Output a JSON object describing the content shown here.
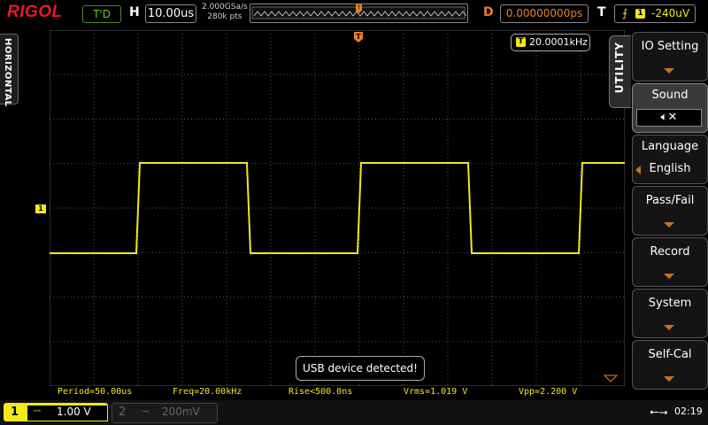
{
  "header": {
    "brand": "RIGOL",
    "run_status": "T'D",
    "h_label": "H",
    "timebase": "10.00us",
    "sample_rate": "2.000GSa/s",
    "memory_depth": "280k pts",
    "d_label": "D",
    "delay": "0.00000000ps",
    "t_label": "T",
    "trigger_source": "1",
    "trigger_level": "-240uV"
  },
  "left_tab": {
    "label": "HORIZONTAL"
  },
  "trigger_marker": "T",
  "channel_marker": "1",
  "frequency_counter": {
    "icon_label": "T",
    "value": "20.0001kHz"
  },
  "notification": "USB device detected!",
  "menu": {
    "title": "UTILITY",
    "items": [
      {
        "label": "IO Setting"
      },
      {
        "label": "Sound",
        "value_icon": "speaker-mute-icon"
      },
      {
        "label": "Language",
        "value": "English"
      },
      {
        "label": "Pass/Fail"
      },
      {
        "label": "Record"
      },
      {
        "label": "System"
      },
      {
        "label": "Self-Cal"
      }
    ]
  },
  "measurements": [
    "Period=50.00us",
    "Freq=20.00kHz",
    "Rise<500.0ns",
    "Vrms=1.019 V",
    "Vpp=2.200 V"
  ],
  "channels": [
    {
      "number": "1",
      "coupling": "DC",
      "scale": "1.00 V",
      "active": true
    },
    {
      "number": "2",
      "coupling": "AC",
      "scale": "200mV",
      "active": false
    }
  ],
  "status_bar": {
    "time": "02:19"
  },
  "colors": {
    "ch1": "#f2e81c",
    "brand": "#e31b23",
    "accent_orange": "#e88020",
    "status_green": "#58d01c"
  },
  "waveform": {
    "type": "square",
    "period_divisions": 5,
    "high_division": 2.0,
    "low_division": 0.0,
    "first_rising_edge_division": 2.0
  }
}
